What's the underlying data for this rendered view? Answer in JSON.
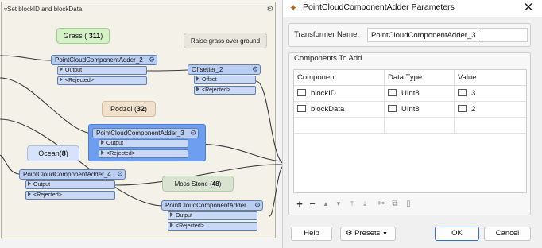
{
  "canvas": {
    "bookmark_title": "Set blockID and blockData",
    "annotations": {
      "grass": {
        "name": "Grass (",
        "count": "311",
        "close": ")"
      },
      "raise": "Raise grass over ground",
      "podzol": {
        "name": "Podzol (",
        "count": "32",
        "close": ")"
      },
      "ocean": {
        "name": "Ocean(",
        "count": "8",
        "close": ")"
      },
      "moss": {
        "name": "Moss Stone (",
        "count": "48",
        "close": ")"
      }
    },
    "nodes": {
      "adder2": {
        "title": "PointCloudComponentAdder_2",
        "ports": [
          "Output",
          "<Rejected>"
        ]
      },
      "offsetter2": {
        "title": "Offsetter_2",
        "ports": [
          "Offset",
          "<Rejected>"
        ]
      },
      "adder3": {
        "title": "PointCloudComponentAdder_3",
        "ports": [
          "Output",
          "<Rejected>"
        ]
      },
      "adder4": {
        "title": "PointCloudComponentAdder_4",
        "ports": [
          "Output",
          "<Rejected>"
        ]
      },
      "adder": {
        "title": "PointCloudComponentAdder",
        "ports": [
          "Output",
          "<Rejected>"
        ]
      }
    }
  },
  "dialog": {
    "title": "PointCloudComponentAdder Parameters",
    "transformer_name_label": "Transformer Name:",
    "transformer_name_value": "PointCloudComponentAdder_3",
    "components_label": "Components To Add",
    "columns": [
      "Component",
      "Data Type",
      "Value"
    ],
    "rows": [
      {
        "component": "blockID",
        "data_type": "UInt8",
        "value": "3"
      },
      {
        "component": "blockData",
        "data_type": "UInt8",
        "value": "2"
      }
    ],
    "toolbar_icons": [
      "plus-icon",
      "minus-icon",
      "move-up-icon",
      "move-down-icon",
      "move-top-icon",
      "move-bottom-icon",
      "cut-icon",
      "copy-icon",
      "paste-icon"
    ],
    "buttons": {
      "help": "Help",
      "presets": "Presets",
      "ok": "OK",
      "cancel": "Cancel"
    }
  }
}
